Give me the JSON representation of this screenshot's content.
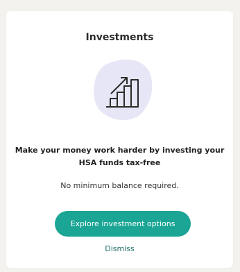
{
  "card": {
    "title": "Investments",
    "illustration_icon": "growth-chart-icon",
    "headline": "Make your money work harder by investing your HSA funds tax-free",
    "subtext": "No minimum balance required.",
    "cta_label": "Explore investment options",
    "dismiss_label": "Dismiss"
  },
  "colors": {
    "page_background": "#f3f2ee",
    "card_background": "#ffffff",
    "accent": "#1aa594",
    "illustration_blob": "#e6e6f6",
    "link": "#1f6f66"
  }
}
